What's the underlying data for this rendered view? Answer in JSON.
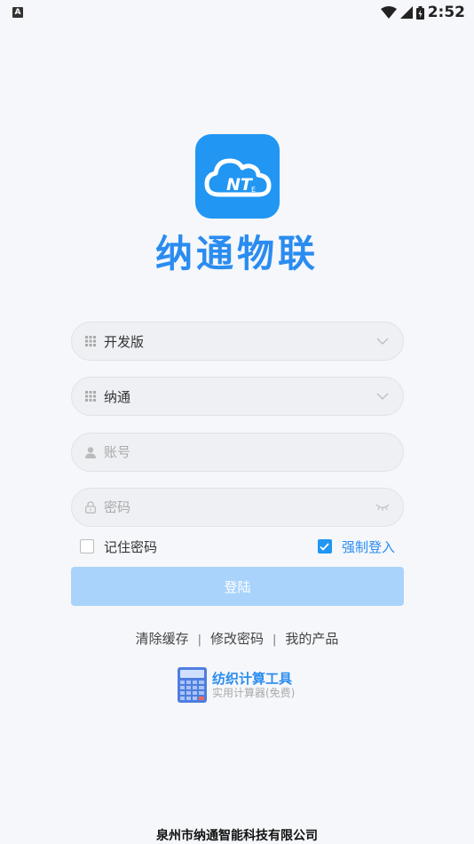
{
  "status_bar": {
    "time": "2:52",
    "notification_icon": "A"
  },
  "app": {
    "logo_text": "NTE",
    "title": "纳通物联"
  },
  "form": {
    "edition_select": {
      "value": "开发版",
      "icon": "grid-icon"
    },
    "company_select": {
      "value": "纳通",
      "icon": "grid-icon"
    },
    "account_input": {
      "placeholder": "账号"
    },
    "password_input": {
      "placeholder": "密码"
    },
    "remember_password": {
      "label": "记住密码",
      "checked": false
    },
    "force_login": {
      "label": "强制登入",
      "checked": true
    },
    "login_button": "登陆"
  },
  "links": {
    "clear_cache": "清除缓存",
    "change_password": "修改密码",
    "my_products": "我的产品",
    "separator": "|"
  },
  "promo": {
    "title": "纺织计算工具",
    "subtitle": "实用计算器(免费)"
  },
  "footer": {
    "company": "泉州市纳通智能科技有限公司"
  },
  "colors": {
    "primary": "#2196f3",
    "brand_text": "#2a8cf0",
    "button_disabled": "#a9d3fb",
    "background": "#f5f7fa"
  }
}
